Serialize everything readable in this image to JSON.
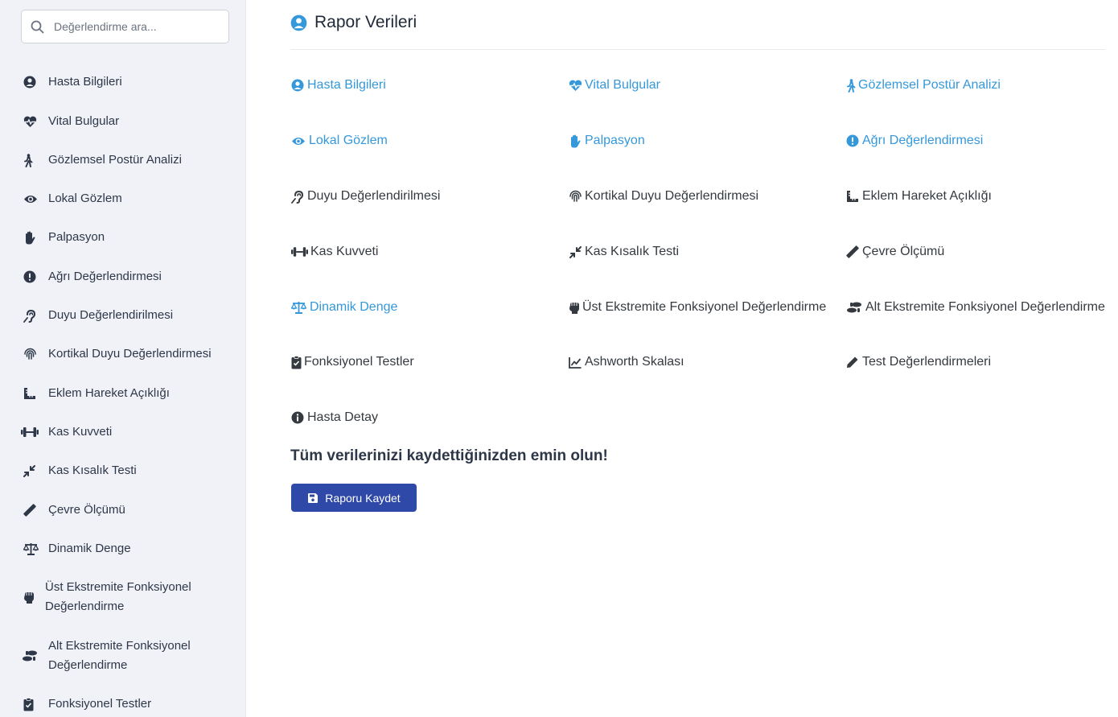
{
  "search": {
    "placeholder": "Değerlendirme ara..."
  },
  "sidebar": {
    "items": [
      {
        "label": "Hasta Bilgileri",
        "icon": "user-circle-icon"
      },
      {
        "label": "Vital Bulgular",
        "icon": "heartbeat-icon"
      },
      {
        "label": "Gözlemsel Postür Analizi",
        "icon": "walking-icon"
      },
      {
        "label": "Lokal Gözlem",
        "icon": "eye-icon"
      },
      {
        "label": "Palpasyon",
        "icon": "hand-icon"
      },
      {
        "label": "Ağrı Değerlendirmesi",
        "icon": "exclamation-circle-icon"
      },
      {
        "label": "Duyu Değerlendirilmesi",
        "icon": "ear-icon"
      },
      {
        "label": "Kortikal Duyu Değerlendirmesi",
        "icon": "fingerprint-icon"
      },
      {
        "label": "Eklem Hareket Açıklığı",
        "icon": "ruler-combined-icon"
      },
      {
        "label": "Kas Kuvveti",
        "icon": "dumbbell-icon"
      },
      {
        "label": "Kas Kısalık Testi",
        "icon": "compress-icon"
      },
      {
        "label": "Çevre Ölçümü",
        "icon": "ruler-icon"
      },
      {
        "label": "Dinamik Denge",
        "icon": "balance-scale-icon"
      },
      {
        "label": "Üst Ekstremite Fonksiyonel Değerlendirme",
        "icon": "fist-icon"
      },
      {
        "label": "Alt Ekstremite Fonksiyonel Değerlendirme",
        "icon": "shoe-prints-icon"
      },
      {
        "label": "Fonksiyonel Testler",
        "icon": "clipboard-check-icon"
      }
    ]
  },
  "main": {
    "title": "Rapor Verileri",
    "links": [
      {
        "label": "Hasta Bilgileri",
        "icon": "user-circle-icon",
        "state": "completed"
      },
      {
        "label": "Vital Bulgular",
        "icon": "heartbeat-icon",
        "state": "completed"
      },
      {
        "label": "Gözlemsel Postür Analizi",
        "icon": "walking-icon",
        "state": "completed"
      },
      {
        "label": "Lokal Gözlem",
        "icon": "eye-icon",
        "state": "completed"
      },
      {
        "label": "Palpasyon",
        "icon": "hand-icon",
        "state": "completed"
      },
      {
        "label": "Ağrı Değerlendirmesi",
        "icon": "exclamation-circle-icon",
        "state": "completed"
      },
      {
        "label": "Duyu Değerlendirilmesi",
        "icon": "ear-icon",
        "state": "pending"
      },
      {
        "label": "Kortikal Duyu Değerlendirmesi",
        "icon": "fingerprint-icon",
        "state": "pending"
      },
      {
        "label": "Eklem Hareket Açıklığı",
        "icon": "ruler-combined-icon",
        "state": "pending"
      },
      {
        "label": "Kas Kuvveti",
        "icon": "dumbbell-icon",
        "state": "pending"
      },
      {
        "label": "Kas Kısalık Testi",
        "icon": "compress-icon",
        "state": "pending"
      },
      {
        "label": "Çevre Ölçümü",
        "icon": "ruler-icon",
        "state": "pending"
      },
      {
        "label": "Dinamik Denge",
        "icon": "balance-scale-icon",
        "state": "completed"
      },
      {
        "label": "Üst Ekstremite Fonksiyonel Değerlendirme",
        "icon": "fist-icon",
        "state": "pending"
      },
      {
        "label": "Alt Ekstremite Fonksiyonel Değerlendirme",
        "icon": "shoe-prints-icon",
        "state": "pending"
      },
      {
        "label": "Fonksiyonel Testler",
        "icon": "clipboard-check-icon",
        "state": "pending"
      },
      {
        "label": "Ashworth Skalası",
        "icon": "chart-line-icon",
        "state": "pending"
      },
      {
        "label": "Test Değerlendirmeleri",
        "icon": "pen-icon",
        "state": "pending"
      },
      {
        "label": "Hasta Detay",
        "icon": "info-circle-icon",
        "state": "pending"
      }
    ],
    "warning": "Tüm verilerinizi kaydettiğinizden emin olun!",
    "save_label": "Raporu Kaydet"
  },
  "colors": {
    "completed": "#3498db",
    "pending": "#343a40",
    "primary_button": "#2f49a8",
    "sidebar_bg": "#f1f2f8"
  }
}
